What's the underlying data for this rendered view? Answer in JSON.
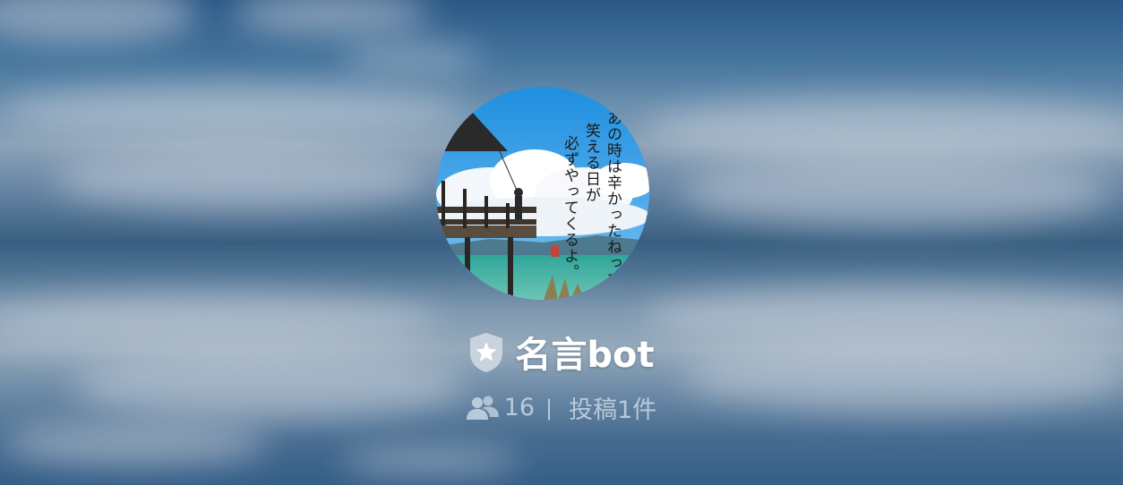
{
  "community": {
    "name": "名言bot",
    "member_count": "16",
    "separator": "|",
    "post_count_label": "投稿1件"
  },
  "avatar": {
    "calligraphy_lines": [
      "あの時は辛かったねって",
      "笑える日が",
      "必ずやってくるよ。"
    ]
  },
  "icons": {
    "badge": "shield-star-icon",
    "members": "members-icon"
  },
  "colors": {
    "title": "#ffffff",
    "stats": "#becddc",
    "badge": "#c8d3dd"
  }
}
